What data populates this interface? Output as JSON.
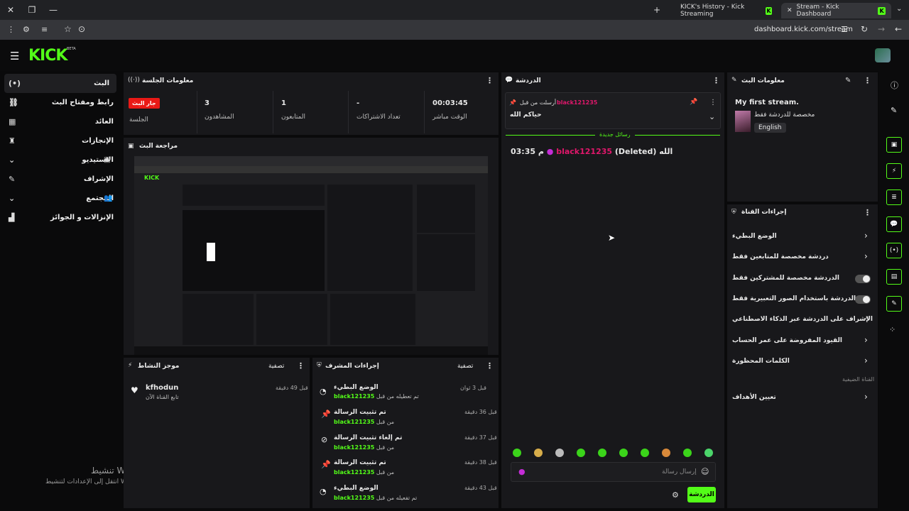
{
  "browser": {
    "tabs": [
      {
        "title": "KICK's History - Kick Streaming"
      },
      {
        "title": "Stream - Kick Dashboard"
      }
    ],
    "url": "dashboard.kick.com/stream"
  },
  "header": {
    "logo": "KICK",
    "beta": "BETA"
  },
  "nav": {
    "items": [
      {
        "label": "البث"
      },
      {
        "label": "رابط ومفتاح البث"
      },
      {
        "label": "العائد"
      },
      {
        "label": "الإنجازات"
      },
      {
        "label": "الاستيديو"
      },
      {
        "label": "الإشراف"
      },
      {
        "label": "المجتمع"
      },
      {
        "label": "الإنزالات و الجوائز"
      }
    ]
  },
  "session": {
    "title": "معلومات الجلسة",
    "live_badge": "جار البث",
    "session_label": "الجلسة",
    "viewers_value": "3",
    "viewers_label": "المشاهدون",
    "followers_value": "1",
    "followers_label": "المتابعون",
    "subs_value": "-",
    "subs_label": "تعداد الاشتراكات",
    "uptime_value": "00:03:45",
    "uptime_label": "الوقت مباشر"
  },
  "preview": {
    "title": "مراجعة البث"
  },
  "activity": {
    "title": "موجز النشاط",
    "filter": "تصفية",
    "items": [
      {
        "user": "kfhodun",
        "text": "تابع القناة الآن",
        "time": "قبل 49 دقيقة"
      }
    ]
  },
  "modactions": {
    "title": "إجراءات المشرف",
    "filter": "تصفية",
    "items": [
      {
        "action": "الوضع البطيء",
        "detail": "تم تعطيله من قبل",
        "user": "black121235",
        "time": "قبل 3 ثوان"
      },
      {
        "action": "تم تثبيت الرسالة",
        "detail": "من قبل",
        "user": "black121235",
        "time": "قبل 36 دقيقة"
      },
      {
        "action": "تم إلغاء تثبيت الرسالة",
        "detail": "من قبل",
        "user": "black121235",
        "time": "قبل 37 دقيقة"
      },
      {
        "action": "تم تثبيت الرسالة",
        "detail": "من قبل",
        "user": "black121235",
        "time": "قبل 38 دقيقة"
      },
      {
        "action": "الوضع البطيء",
        "detail": "تم تفعيله من قبل",
        "user": "black121235",
        "time": "قبل 43 دقيقة"
      }
    ]
  },
  "chat": {
    "title": "الدردشة",
    "pinned_by": "أرسلت من قبل",
    "pinned_user": "black121235",
    "pinned_text": "حياكم الله",
    "new_messages": "رسائل جديدة",
    "msg_time": "03:35",
    "msg_user": "black121235",
    "msg_text": "(Deleted) الله",
    "msg_sep": "م",
    "input_placeholder": "إرسال رسالة",
    "send_label": "الدردشة"
  },
  "stream_info": {
    "title": "معلومات البث",
    "stream_title": "My first stream.",
    "category": "مخصصة للدردشة فقط",
    "language": "English"
  },
  "channel_actions": {
    "title": "إجراءات القناة",
    "items": [
      {
        "label": "الوضع البطيء"
      },
      {
        "label": "دردشة مخصصة للمتابعين فقط"
      },
      {
        "label": "الدردشة مخصصة للمشتركين فقط"
      },
      {
        "label": "الدردشة باستخدام الصور التعبيرية فقط"
      },
      {
        "label": "الإشراف على الدردشة عبر الذكاء الاصطناعي"
      },
      {
        "label": "القيود المفروضة على عمر الحساب"
      },
      {
        "label": "الكلمات المحظورة"
      }
    ],
    "section": "القناة الضيفية",
    "goals": "تعيين الأهداف"
  },
  "windows": {
    "activate": "تنشيط Windows",
    "activate_hint": "انتقل إلى الإعدادات لتنشيط Windows."
  },
  "colors": {
    "accent": "#53fc18",
    "live": "#e91916",
    "user": "#e0176b"
  }
}
